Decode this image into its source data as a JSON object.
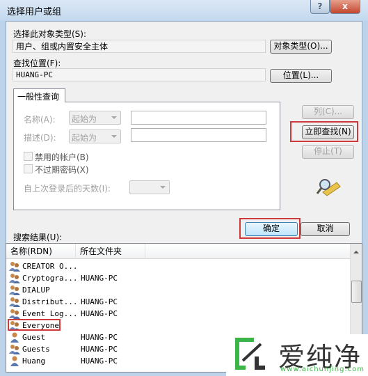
{
  "window": {
    "title": "选择用户或组",
    "help_label": "?",
    "close_label": "x"
  },
  "object_type": {
    "label": "选择此对象类型(S):",
    "value": "用户、组或内置安全主体",
    "button": "对象类型(O)..."
  },
  "location": {
    "label": "查找位置(F):",
    "value": "HUANG-PC",
    "button": "位置(L)..."
  },
  "query": {
    "tab": "一般性查询",
    "name_label": "名称(A):",
    "name_mode": "起始为",
    "name_value": "",
    "desc_label": "描述(D):",
    "desc_mode": "起始为",
    "desc_value": "",
    "disabled_accounts": "禁用的帐户(B)",
    "no_expire_pw": "不过期密码(X)",
    "days_label": "自上次登录后的天数(I):",
    "days_value": ""
  },
  "side_buttons": {
    "columns": "列(C)...",
    "find_now": "立即查找(N)",
    "stop": "停止(T)"
  },
  "actions": {
    "ok": "确定",
    "cancel": "取消"
  },
  "results": {
    "label": "搜索结果(U):",
    "columns": [
      "名称(RDN)",
      "所在文件夹"
    ],
    "rows": [
      {
        "name": "CREATOR O...",
        "folder": "",
        "icon": "group-icon"
      },
      {
        "name": "Cryptogra...",
        "folder": "HUANG-PC",
        "icon": "group-icon"
      },
      {
        "name": "DIALUP",
        "folder": "",
        "icon": "group-icon"
      },
      {
        "name": "Distribut...",
        "folder": "HUANG-PC",
        "icon": "group-icon"
      },
      {
        "name": "Event Log...",
        "folder": "HUANG-PC",
        "icon": "group-icon"
      },
      {
        "name": "Everyone",
        "folder": "",
        "icon": "group-icon"
      },
      {
        "name": "Guest",
        "folder": "HUANG-PC",
        "icon": "user-icon"
      },
      {
        "name": "Guests",
        "folder": "HUANG-PC",
        "icon": "group-icon"
      },
      {
        "name": "Huang",
        "folder": "HUANG-PC",
        "icon": "user-icon"
      }
    ]
  },
  "watermark": {
    "text": "爱纯净",
    "url": "www.aichunjing.com"
  },
  "colors": {
    "highlight": "#d0393a",
    "watermark_green": "#3bb54a"
  }
}
